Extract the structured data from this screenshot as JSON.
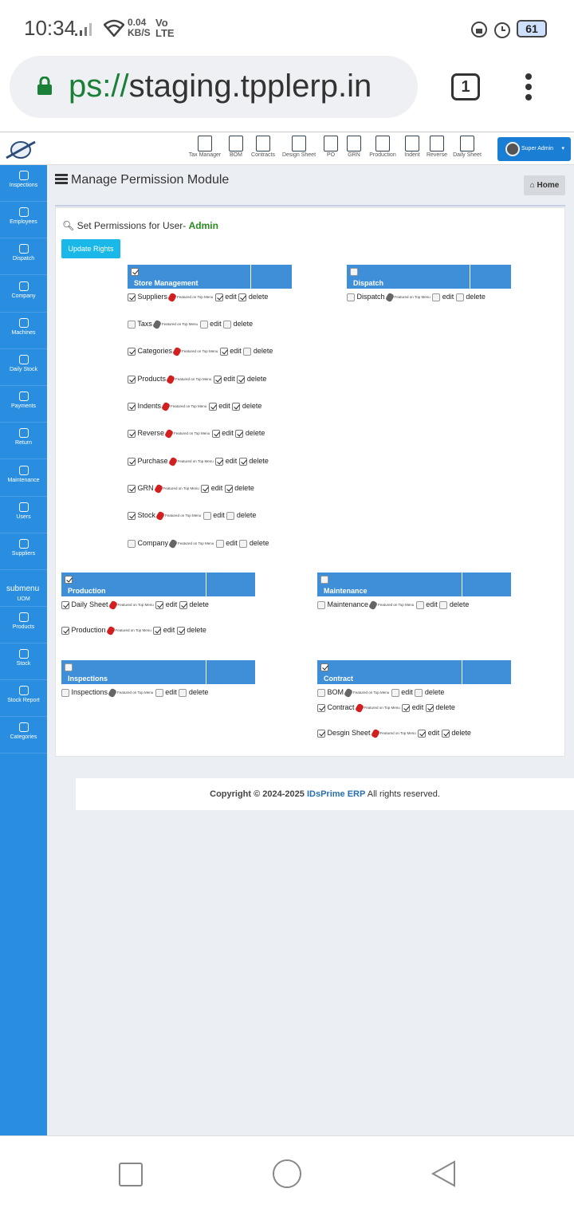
{
  "status_bar": {
    "time": "10:34",
    "net_speed": "0.04 KB/S",
    "network": "Vo LTE",
    "battery": "61"
  },
  "browser": {
    "url_scheme_part": "ps://",
    "url_host": "staging.tpplerp.in",
    "tab_count": "1"
  },
  "toolbar": {
    "items": [
      "Tax Manager",
      "BOM",
      "Contracts",
      "Design Sheet",
      "PO",
      "GRN",
      "Production",
      "Indent",
      "Reverse",
      "Daily Sheet"
    ],
    "user_label": "Super Admin"
  },
  "sidebar": {
    "items": [
      "Inspections",
      "Employees",
      "Dispatch",
      "Company",
      "Machines",
      "Daily Stock",
      "Payments",
      "Return",
      "Maintenance",
      "Users",
      "Suppliers",
      "UOM",
      "Products",
      "Stock",
      "Stock Report",
      "Categories"
    ],
    "broken_image_alt": "submenu"
  },
  "page": {
    "title": "Manage Permission Module",
    "home_label": "Home",
    "set_permissions_prefix": "Set Permissions for User-",
    "user": "Admin",
    "update_button": "Update Rights",
    "featured_text": "Featured on Top Menu",
    "edit_label": "edit",
    "delete_label": "delete"
  },
  "modules": [
    {
      "name": "Store Management",
      "checked": true,
      "items": [
        {
          "label": "Suppliers",
          "tag": "red",
          "view": true,
          "edit": true,
          "delete": true
        },
        {
          "label": "Taxs",
          "tag": "gray",
          "view": false,
          "edit": false,
          "delete": false
        },
        {
          "label": "Categories",
          "tag": "red",
          "view": true,
          "edit": true,
          "delete": false
        },
        {
          "label": "Products",
          "tag": "red",
          "view": true,
          "edit": true,
          "delete": true
        },
        {
          "label": "Indents",
          "tag": "red",
          "view": true,
          "edit": true,
          "delete": true
        },
        {
          "label": "Reverse",
          "tag": "red",
          "view": true,
          "edit": true,
          "delete": true
        },
        {
          "label": "Purchase",
          "tag": "red",
          "view": true,
          "edit": true,
          "delete": true
        },
        {
          "label": "GRN",
          "tag": "red",
          "view": true,
          "edit": true,
          "delete": true
        },
        {
          "label": "Stock",
          "tag": "red",
          "view": true,
          "edit": false,
          "delete": false
        },
        {
          "label": "Company",
          "tag": "gray",
          "view": false,
          "edit": false,
          "delete": false
        }
      ]
    },
    {
      "name": "Dispatch",
      "checked": false,
      "items": [
        {
          "label": "Dispatch",
          "tag": "gray",
          "view": false,
          "edit": false,
          "delete": false
        }
      ]
    },
    {
      "name": "Production",
      "checked": true,
      "items": [
        {
          "label": "Daily Sheet",
          "tag": "red",
          "view": true,
          "edit": true,
          "delete": true
        },
        {
          "label": "Production",
          "tag": "red",
          "view": true,
          "edit": true,
          "delete": true
        }
      ]
    },
    {
      "name": "Maintenance",
      "checked": false,
      "items": [
        {
          "label": "Maintenance",
          "tag": "gray",
          "view": false,
          "edit": false,
          "delete": false
        }
      ]
    },
    {
      "name": "Inspections",
      "checked": false,
      "items": [
        {
          "label": "Inspections",
          "tag": "gray",
          "view": false,
          "edit": false,
          "delete": false
        }
      ]
    },
    {
      "name": "Contract",
      "checked": true,
      "items": [
        {
          "label": "BOM",
          "tag": "gray",
          "view": false,
          "edit": false,
          "delete": false
        },
        {
          "label": "Contract",
          "tag": "red",
          "view": true,
          "edit": true,
          "delete": true
        },
        {
          "label": "Desgin Sheet",
          "tag": "red",
          "view": true,
          "edit": true,
          "delete": true
        }
      ]
    }
  ],
  "footer": {
    "copyright": "Copyright © 2024-2025",
    "brand": "IDsPrime ERP",
    "rights": "All rights reserved."
  }
}
